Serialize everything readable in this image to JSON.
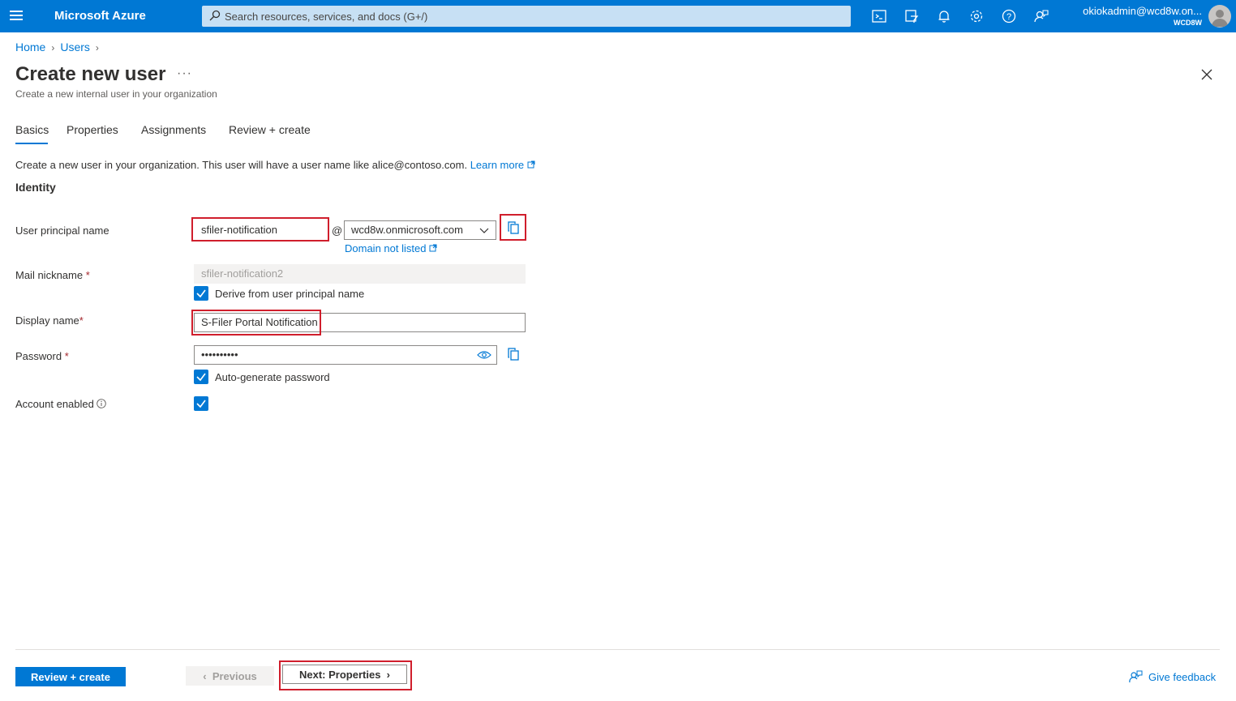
{
  "topbar": {
    "brand": "Microsoft Azure",
    "search_placeholder": "Search resources, services, and docs (G+/)",
    "account_email": "okiokadmin@wcd8w.on...",
    "account_tenant": "WCD8W",
    "icons": [
      "cloud-shell-icon",
      "directory-filter-icon",
      "notifications-icon",
      "settings-icon",
      "help-icon",
      "feedback-icon"
    ]
  },
  "breadcrumb": {
    "items": [
      "Home",
      "Users"
    ]
  },
  "page": {
    "title": "Create new user",
    "more": "···",
    "subtitle": "Create a new internal user in your organization"
  },
  "tabs": [
    {
      "label": "Basics",
      "active": true
    },
    {
      "label": "Properties",
      "active": false
    },
    {
      "label": "Assignments",
      "active": false
    },
    {
      "label": "Review + create",
      "active": false
    }
  ],
  "intro": {
    "text": "Create a new user in your organization. This user will have a user name like alice@contoso.com.",
    "link": "Learn more"
  },
  "identity": {
    "heading": "Identity",
    "upn_label": "User principal name",
    "upn_value": "sfiler-notification",
    "at": "@",
    "domain_value": "wcd8w.onmicrosoft.com",
    "domain_link": "Domain not listed",
    "mail_label": "Mail nickname",
    "mail_value": "sfiler-notification2",
    "derive_label": "Derive from user principal name",
    "display_label": "Display name",
    "display_value": "S-Filer Portal Notification",
    "password_label": "Password",
    "password_value": "••••••••••",
    "autogen_label": "Auto-generate password",
    "account_label": "Account enabled",
    "required_mark": "*"
  },
  "footer": {
    "review_create": "Review + create",
    "previous": "Previous",
    "next": "Next: Properties",
    "feedback": "Give feedback"
  },
  "colors": {
    "accent": "#0078d4",
    "highlight": "#d01e2c"
  }
}
